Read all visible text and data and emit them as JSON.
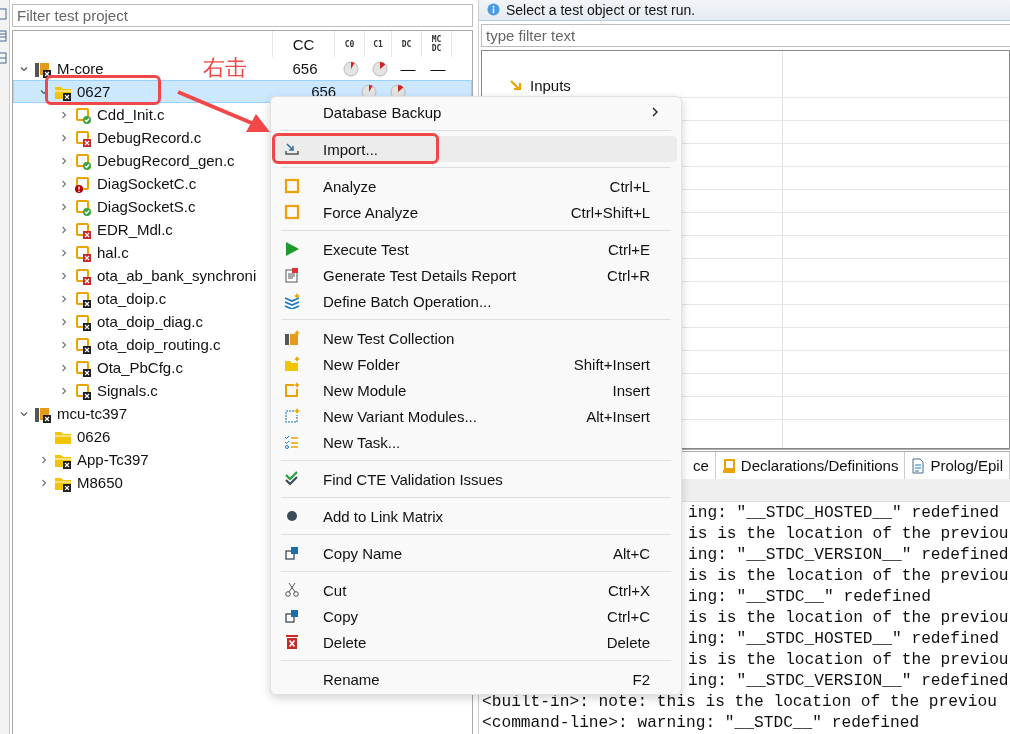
{
  "left_panel": {
    "filter": {
      "placeholder": "Filter test project"
    },
    "columns": [
      "CC",
      "C0",
      "C1",
      "DC",
      "MC DC"
    ],
    "tree": [
      {
        "label": "M-core",
        "kind": "project",
        "badge": {
          "kind": "cross",
          "color": "#1d1d1d"
        },
        "expandable": true,
        "expanded": true,
        "selected": false,
        "metrics": {
          "cc": "656",
          "pies": true,
          "dc": "—",
          "mcdc": "—"
        },
        "children": [
          {
            "label": "0627",
            "kind": "folder",
            "badge": {
              "kind": "cross",
              "color": "#1d1d1d"
            },
            "expandable": true,
            "expanded": true,
            "selected": true,
            "metrics": {
              "cc": "656",
              "pies": true
            },
            "children": [
              {
                "label": "Cdd_Init.c",
                "kind": "file",
                "badge": {
                  "kind": "check",
                  "color": "#3aa53a"
                },
                "expandable": true,
                "expanded": false,
                "selected": false
              },
              {
                "label": "DebugRecord.c",
                "kind": "file",
                "badge": {
                  "kind": "cross",
                  "color": "#c62828"
                },
                "expandable": true,
                "expanded": false,
                "selected": false
              },
              {
                "label": "DebugRecord_gen.c",
                "kind": "file",
                "badge": {
                  "kind": "check",
                  "color": "#3aa53a"
                },
                "expandable": true,
                "expanded": false,
                "selected": false
              },
              {
                "label": "DiagSocketC.c",
                "kind": "file",
                "badge": {
                  "kind": "alert",
                  "color": "#b00000"
                },
                "expandable": true,
                "expanded": false,
                "selected": false
              },
              {
                "label": "DiagSocketS.c",
                "kind": "file",
                "badge": {
                  "kind": "check",
                  "color": "#3aa53a"
                },
                "expandable": true,
                "expanded": false,
                "selected": false
              },
              {
                "label": "EDR_Mdl.c",
                "kind": "file",
                "badge": {
                  "kind": "cross",
                  "color": "#c62828"
                },
                "expandable": true,
                "expanded": false,
                "selected": false
              },
              {
                "label": "hal.c",
                "kind": "file",
                "badge": {
                  "kind": "cross",
                  "color": "#c62828"
                },
                "expandable": true,
                "expanded": false,
                "selected": false
              },
              {
                "label": "ota_ab_bank_synchroni",
                "kind": "file",
                "badge": {
                  "kind": "cross",
                  "color": "#c62828"
                },
                "expandable": true,
                "expanded": false,
                "selected": false
              },
              {
                "label": "ota_doip.c",
                "kind": "file",
                "badge": {
                  "kind": "cross",
                  "color": "#1d1d1d"
                },
                "expandable": true,
                "expanded": false,
                "selected": false
              },
              {
                "label": "ota_doip_diag.c",
                "kind": "file",
                "badge": {
                  "kind": "cross",
                  "color": "#1d1d1d"
                },
                "expandable": true,
                "expanded": false,
                "selected": false
              },
              {
                "label": "ota_doip_routing.c",
                "kind": "file",
                "badge": {
                  "kind": "cross",
                  "color": "#1d1d1d"
                },
                "expandable": true,
                "expanded": false,
                "selected": false
              },
              {
                "label": "Ota_PbCfg.c",
                "kind": "file",
                "badge": {
                  "kind": "cross",
                  "color": "#1d1d1d"
                },
                "expandable": true,
                "expanded": false,
                "selected": false
              },
              {
                "label": "Signals.c",
                "kind": "file",
                "badge": {
                  "kind": "cross",
                  "color": "#1d1d1d"
                },
                "expandable": true,
                "expanded": false,
                "selected": false
              }
            ]
          }
        ]
      },
      {
        "label": "mcu-tc397",
        "kind": "project",
        "badge": {
          "kind": "cross",
          "color": "#1d1d1d"
        },
        "expandable": true,
        "expanded": true,
        "selected": false,
        "children": [
          {
            "label": "0626",
            "kind": "folder",
            "expandable": false,
            "selected": false
          },
          {
            "label": "App-Tc397",
            "kind": "folder",
            "badge": {
              "kind": "cross",
              "color": "#1d1d1d"
            },
            "expandable": true,
            "expanded": false,
            "selected": false
          },
          {
            "label": "M8650",
            "kind": "folder",
            "badge": {
              "kind": "cross",
              "color": "#1d1d1d"
            },
            "expandable": true,
            "expanded": false,
            "selected": false
          }
        ]
      }
    ]
  },
  "annotation": {
    "label": "右击"
  },
  "right_panel": {
    "info": "Select a test object or test run.",
    "filter": {
      "placeholder": "type filter text"
    },
    "table_rows": [
      {
        "label": "Inputs"
      }
    ],
    "tabs": [
      {
        "label": "ce"
      },
      {
        "label": "Declarations/Definitions"
      },
      {
        "label": "Prolog/Epil"
      }
    ],
    "console": {
      "partial_lines": [
        "ing: \"__STDC_HOSTED__\" redefined",
        "is is the location of the previou",
        "ing: \"__STDC_VERSION__\" redefined",
        "is is the location of the previou",
        "ing: \"__STDC__\" redefined",
        "is is the location of the previou",
        "ing: \"__STDC_HOSTED__\" redefined",
        "is is the location of the previou",
        "ing: \"__STDC_VERSION__\" redefined"
      ],
      "lines": [
        "<built-in>: note: this is the location of the previou",
        "<command-line>: warning: \"__STDC__\" redefined"
      ]
    }
  },
  "context_menu": {
    "groups": [
      [
        {
          "label": "Database Backup",
          "submenu": true,
          "selected": false
        }
      ],
      [
        {
          "label": "Import...",
          "submenu": false,
          "selected": true
        }
      ],
      [
        {
          "label": "Analyze",
          "shortcut": "Ctrl+L",
          "submenu": false,
          "selected": false
        },
        {
          "label": "Force Analyze",
          "shortcut": "Ctrl+Shift+L",
          "submenu": false,
          "selected": false
        }
      ],
      [
        {
          "label": "Execute Test",
          "shortcut": "Ctrl+E",
          "submenu": false,
          "selected": false
        },
        {
          "label": "Generate Test Details Report",
          "shortcut": "Ctrl+R",
          "submenu": false,
          "selected": false
        },
        {
          "label": "Define Batch Operation...",
          "submenu": false,
          "selected": false
        }
      ],
      [
        {
          "label": "New Test Collection",
          "submenu": false,
          "selected": false
        },
        {
          "label": "New Folder",
          "shortcut": "Shift+Insert",
          "submenu": false,
          "selected": false
        },
        {
          "label": "New Module",
          "shortcut": "Insert",
          "submenu": false,
          "selected": false
        },
        {
          "label": "New Variant Modules...",
          "shortcut": "Alt+Insert",
          "submenu": false,
          "selected": false
        },
        {
          "label": "New Task...",
          "submenu": false,
          "selected": false
        }
      ],
      [
        {
          "label": "Find CTE Validation Issues",
          "submenu": false,
          "selected": false
        }
      ],
      [
        {
          "label": "Add to Link Matrix",
          "submenu": false,
          "selected": false
        }
      ],
      [
        {
          "label": "Copy Name",
          "shortcut": "Alt+C",
          "submenu": false,
          "selected": false
        }
      ],
      [
        {
          "label": "Cut",
          "shortcut": "Ctrl+X",
          "submenu": false,
          "selected": false
        },
        {
          "label": "Copy",
          "shortcut": "Ctrl+C",
          "submenu": false,
          "selected": false
        },
        {
          "label": "Delete",
          "shortcut": "Delete",
          "submenu": false,
          "selected": false
        }
      ],
      [
        {
          "label": "Rename",
          "shortcut": "F2",
          "submenu": false,
          "selected": false
        }
      ]
    ]
  }
}
